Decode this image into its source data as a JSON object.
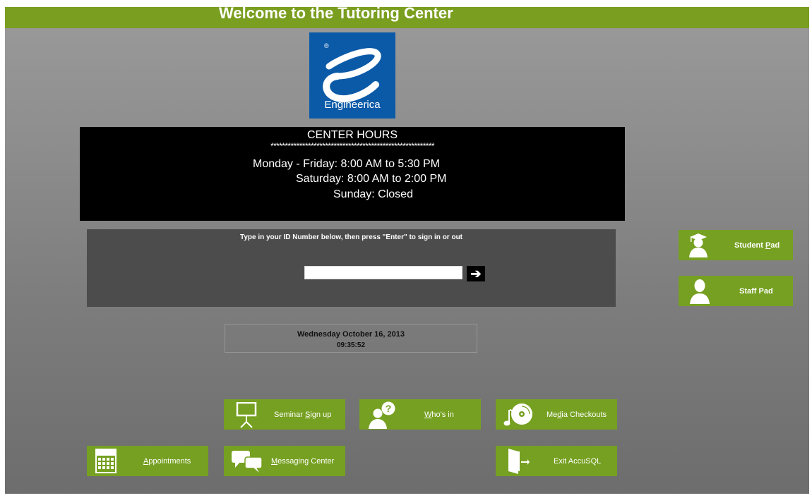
{
  "title": "Welcome to the Tutoring Center",
  "logo": {
    "brand": "Engineerica",
    "registered": "®"
  },
  "hours": {
    "heading": "CENTER HOURS",
    "separator": "*********************************************************",
    "lines": [
      "Monday - Friday: 8:00 AM to 5:30 PM",
      "Saturday:  8:00 AM to 2:00 PM",
      "Sunday:  Closed"
    ]
  },
  "signin": {
    "prompt": "Type in your ID Number below, then press \"Enter\" to sign in or out",
    "input_value": "",
    "enter_icon": "arrow-right-icon",
    "enter_glyph": "➔"
  },
  "datetime": {
    "date": "Wednesday October 16, 2013",
    "time": "09:35:52"
  },
  "side_buttons": {
    "student_pad": {
      "pre": "Student ",
      "mnemonic": "P",
      "post": "ad",
      "icon": "graduate-icon"
    },
    "staff_pad": {
      "label": "Staff Pad",
      "icon": "person-icon"
    }
  },
  "buttons": {
    "seminar": {
      "pre": "Seminar ",
      "mnemonic": "S",
      "post": "ign up",
      "icon": "presentation-board-icon"
    },
    "whos_in": {
      "pre": "",
      "mnemonic": "W",
      "post": "ho's in",
      "icon": "person-question-icon"
    },
    "media": {
      "pre": "Me",
      "mnemonic": "d",
      "post": "ia Checkouts",
      "icon": "music-disc-icon"
    },
    "appointments": {
      "pre": "",
      "mnemonic": "A",
      "post": "ppointments",
      "icon": "calendar-icon"
    },
    "messaging": {
      "pre": "",
      "mnemonic": "M",
      "post": "essaging Center",
      "icon": "chat-bubbles-icon"
    },
    "exit": {
      "label": "Exit AccuSQL",
      "icon": "exit-door-icon"
    }
  },
  "colors": {
    "accent_green": "#76a021",
    "title_bar": "#7a9e1f",
    "logo_blue": "#0b5aa8"
  }
}
